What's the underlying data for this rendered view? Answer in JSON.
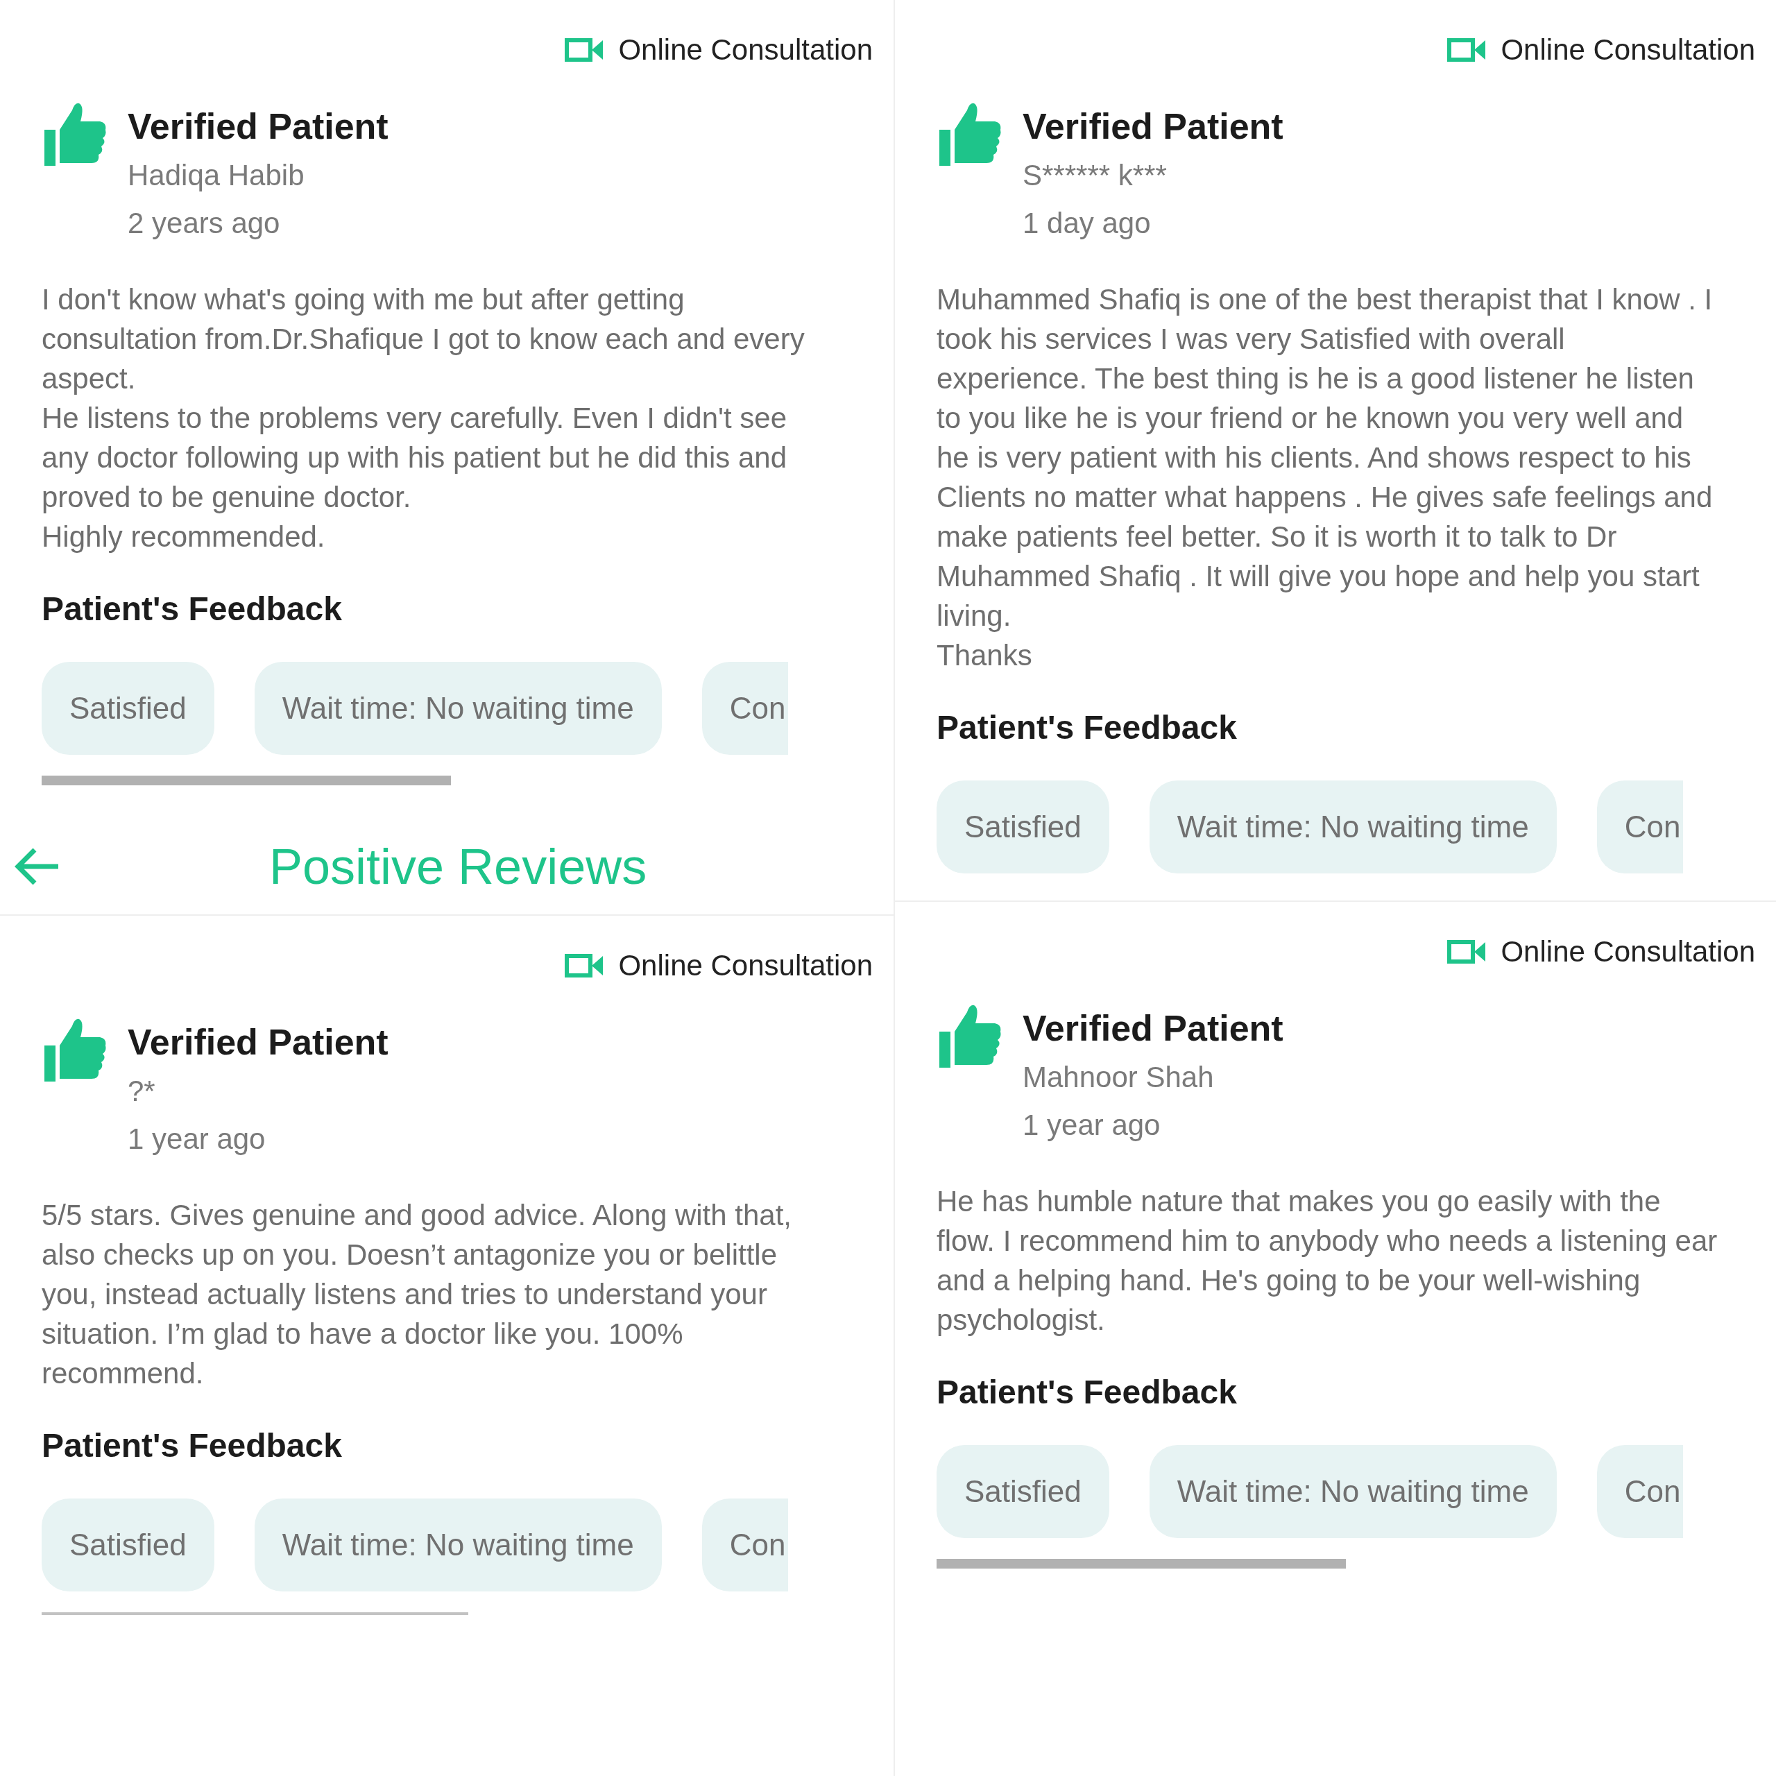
{
  "left_column": [
    {
      "consultation": "Online Consultation",
      "badge": "Verified Patient",
      "name": "Hadiqa Habib",
      "time": "2 years ago",
      "review": "I don't know what's going with me but after getting consultation from.Dr.Shafique I got to know each and every aspect.\nHe listens to the problems very carefully. Even I didn't see any doctor following up with his patient but he did this and proved to be genuine doctor.\nHighly recommended.",
      "feedback_title": "Patient's Feedback",
      "chips": [
        {
          "label": "Satisfied",
          "cut": false
        },
        {
          "label": "Wait time: No waiting time",
          "cut": false
        },
        {
          "label": "Con",
          "cut": true
        }
      ]
    },
    {
      "consultation": "Online Consultation",
      "badge": "Verified Patient",
      "name": "?*",
      "time": "1 year ago",
      "review": "5/5 stars. Gives genuine and good advice. Along with that, also checks up on you. Doesn’t antagonize you or belittle you, instead actually listens and tries to understand your situation. I’m glad to have a doctor like you. 100% recommend.",
      "feedback_title": "Patient's Feedback",
      "chips": [
        {
          "label": "Satisfied",
          "cut": false
        },
        {
          "label": "Wait time: No waiting time",
          "cut": false
        },
        {
          "label": "Con",
          "cut": true
        }
      ]
    }
  ],
  "header": {
    "title": "Positive Reviews"
  },
  "right_column": [
    {
      "consultation": "Online Consultation",
      "badge": "Verified Patient",
      "name": "S****** k***",
      "time": "1 day ago",
      "review": "Muhammed Shafiq is one of the best therapist that I know . I took his services I was very Satisfied with overall experience. The best thing is he is a good listener he listen to you like  he is your friend or he known you very well and he is very patient with his clients. And shows respect to his Clients no matter what happens  . He gives safe feelings and make patients feel better. So it is worth it to talk to Dr Muhammed Shafiq . It will give you hope and help you start living.\nThanks",
      "feedback_title": "Patient's Feedback",
      "chips": [
        {
          "label": "Satisfied",
          "cut": false
        },
        {
          "label": "Wait time: No waiting time",
          "cut": false
        },
        {
          "label": "Con",
          "cut": true
        }
      ]
    },
    {
      "consultation": "Online Consultation",
      "badge": "Verified Patient",
      "name": "Mahnoor Shah",
      "time": "1 year ago",
      "review": "He has humble nature that makes you go easily with the flow. I recommend him to anybody who needs a listening ear and a helping hand. He's going to be your well-wishing psychologist.",
      "feedback_title": "Patient's Feedback",
      "chips": [
        {
          "label": "Satisfied",
          "cut": false
        },
        {
          "label": "Wait time: No waiting time",
          "cut": false
        },
        {
          "label": "Con",
          "cut": true
        }
      ]
    }
  ]
}
